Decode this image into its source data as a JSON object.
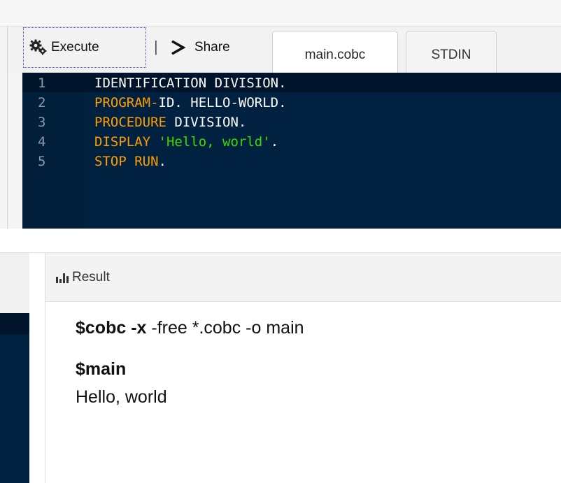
{
  "toolbar": {
    "execute_label": "Execute",
    "separator": "|",
    "share_label": "Share",
    "execute_icon": "gears-icon",
    "share_icon": "share-arrow-icon"
  },
  "tabs": [
    {
      "label": "main.cobc",
      "active": true
    },
    {
      "label": "STDIN",
      "active": false
    }
  ],
  "editor": {
    "lines": [
      {
        "number": "1",
        "tokens": [
          {
            "t": "IDENTIFICATION DIVISION.",
            "c": "plain"
          }
        ]
      },
      {
        "number": "2",
        "tokens": [
          {
            "t": "PROGRAM-",
            "c": "kw"
          },
          {
            "t": "ID. HELLO-",
            "c": "plain"
          },
          {
            "t": "WORLD",
            "c": "plain"
          },
          {
            "t": ".",
            "c": "plain"
          }
        ]
      },
      {
        "number": "3",
        "tokens": [
          {
            "t": "PROCEDURE",
            "c": "kw"
          },
          {
            "t": " DIVISION.",
            "c": "plain"
          }
        ]
      },
      {
        "number": "4",
        "tokens": [
          {
            "t": "DISPLAY",
            "c": "kw"
          },
          {
            "t": " ",
            "c": "plain"
          },
          {
            "t": "'Hello, world'",
            "c": "str"
          },
          {
            "t": ".",
            "c": "plain"
          }
        ]
      },
      {
        "number": "5",
        "tokens": [
          {
            "t": "STOP RUN",
            "c": "kw"
          },
          {
            "t": ".",
            "c": "plain"
          }
        ]
      }
    ]
  },
  "result": {
    "title": "Result",
    "icon": "bar-chart-icon",
    "compile_cmd_prefix": "$cobc ",
    "compile_cmd_flag": "-x",
    "compile_cmd_rest": " -free *.cobc -o main",
    "run_cmd": "$main",
    "output": "Hello, world"
  },
  "colors": {
    "editor_bg": "#002240",
    "keyword": "#ff9d00",
    "string": "#3ad900",
    "line_number": "#8a9aac"
  }
}
